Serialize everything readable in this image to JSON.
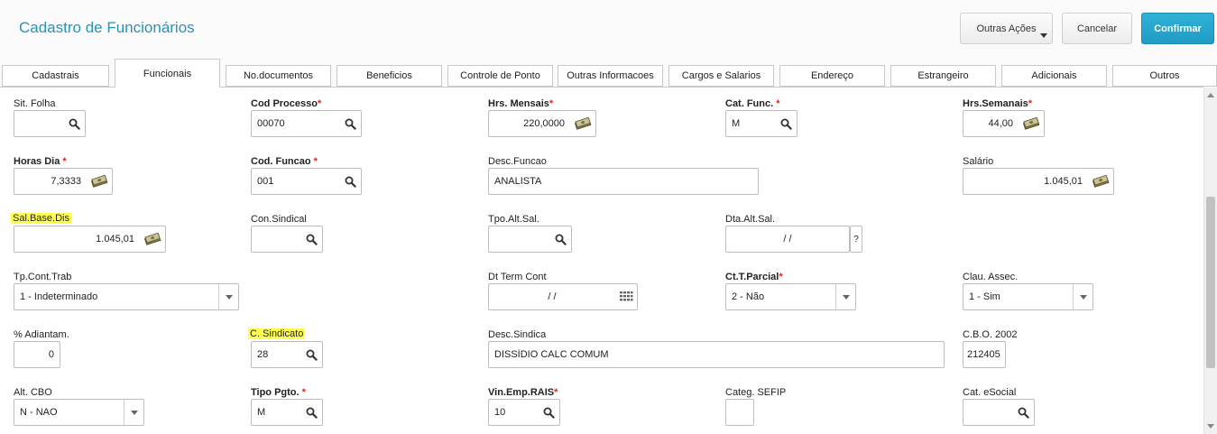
{
  "header": {
    "title": "Cadastro de Funcionários",
    "buttons": {
      "outras": "Outras Ações",
      "cancelar": "Cancelar",
      "confirmar": "Confirmar"
    }
  },
  "tabs": [
    "Cadastrais",
    "Funcionais",
    "No.documentos",
    "Beneficios",
    "Controle de Ponto",
    "Outras Informacoes",
    "Cargos e Salarios",
    "Endereço",
    "Estrangeiro",
    "Adicionais",
    "Outros"
  ],
  "active_tab": "Funcionais",
  "fields": {
    "sit_folha": {
      "label": "Sit. Folha",
      "value": ""
    },
    "cod_processo": {
      "label": "Cod Processo",
      "value": "00070"
    },
    "hrs_mensais": {
      "label": "Hrs. Mensais",
      "value": "220,0000"
    },
    "cat_func": {
      "label": "Cat. Func. ",
      "value": "M"
    },
    "hrs_semanais": {
      "label": "Hrs.Semanais",
      "value": "44,00"
    },
    "horas_dia": {
      "label": "Horas Dia ",
      "value": "7,3333"
    },
    "cod_funcao": {
      "label": "Cod. Funcao ",
      "value": "001"
    },
    "desc_funcao": {
      "label": "Desc.Funcao",
      "value": "ANALISTA"
    },
    "salario": {
      "label": "Salário",
      "value": "1.045,01"
    },
    "sal_base_dis": {
      "label": "Sal.Base.Dis",
      "value": "1.045,01"
    },
    "con_sindical": {
      "label": "Con.Sindical",
      "value": ""
    },
    "tpo_alt_sal": {
      "label": "Tpo.Alt.Sal.",
      "value": ""
    },
    "dta_alt_sal": {
      "label": "Dta.Alt.Sal.",
      "value": "/ /",
      "help": "?"
    },
    "tp_cont_trab": {
      "label": "Tp.Cont.Trab",
      "value": "1 - Indeterminado"
    },
    "dt_term_cont": {
      "label": "Dt Term Cont",
      "value": "/ /"
    },
    "ct_t_parcial": {
      "label": "Ct.T.Parcial",
      "value": "2 - Não"
    },
    "clau_assec": {
      "label": "Clau. Assec.",
      "value": "1 - Sim"
    },
    "pct_adiantam": {
      "label": "% Adiantam.",
      "value": "0"
    },
    "c_sindicato": {
      "label": "C. Sindicato",
      "value": "28"
    },
    "desc_sindica": {
      "label": "Desc.Sindica",
      "value": "DISSÍDIO CALC COMUM"
    },
    "cbo_2002": {
      "label": "C.B.O. 2002",
      "value": "212405"
    },
    "alt_cbo": {
      "label": "Alt. CBO",
      "value": "N - NAO"
    },
    "tipo_pgto": {
      "label": "Tipo Pgto. ",
      "value": "M"
    },
    "vin_emp_rais": {
      "label": "Vin.Emp.RAIS",
      "value": "10"
    },
    "categ_sefip": {
      "label": "Categ. SEFIP",
      "value": ""
    },
    "cat_esocial": {
      "label": "Cat. eSocial",
      "value": ""
    }
  },
  "required_mark": "*",
  "colors": {
    "accent": "#2a93b8",
    "confirm": "#1f9bc4",
    "required": "#e0261f",
    "highlight": "#ffff4d"
  },
  "icons": {
    "lookup": "search-icon",
    "numeric": "money-icon",
    "date": "calendar-icon",
    "dropdown": "chevron-down-icon"
  }
}
